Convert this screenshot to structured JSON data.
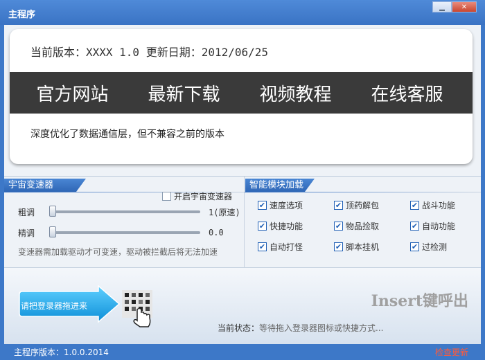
{
  "window": {
    "title": "主程序",
    "min_label": "▁",
    "close_label": "✕"
  },
  "header": {
    "version_line": "当前版本：XXXX 1.0 更新日期：2012/06/25"
  },
  "nav": {
    "items": [
      "官方网站",
      "最新下载",
      "视频教程",
      "在线客服"
    ]
  },
  "notice": "深度优化了数据通信层，但不兼容之前的版本",
  "speed_panel": {
    "title": "宇宙变速器",
    "enable_label": "开启宇宙变速器",
    "enabled": false,
    "coarse_label": "粗调",
    "coarse_value": "1(原速)",
    "coarse_level": 0,
    "fine_label": "精调",
    "fine_value": "0.0",
    "fine_level": 0,
    "note": "变速器需加载驱动才可变速，驱动被拦截后将无法加速"
  },
  "feature_panel": {
    "title": "智能模块加载",
    "items": [
      {
        "label": "速度选项",
        "checked": true
      },
      {
        "label": "顶药解包",
        "checked": true
      },
      {
        "label": "战斗功能",
        "checked": true
      },
      {
        "label": "快捷功能",
        "checked": true
      },
      {
        "label": "物品捡取",
        "checked": true
      },
      {
        "label": "自动功能",
        "checked": true
      },
      {
        "label": "自动打怪",
        "checked": true
      },
      {
        "label": "脚本挂机",
        "checked": true
      },
      {
        "label": "过检测",
        "checked": true
      }
    ]
  },
  "login": {
    "drag_hint": "请把登录器拖进来",
    "hotkey_hint": "Insert键呼出",
    "status_label": "当前状态：",
    "status_text": "等待拖入登录器图标或快捷方式..."
  },
  "statusbar": {
    "version": "主程序版本：1.0.0.2014",
    "check_update": "检查更新"
  },
  "colors": {
    "accent": "#3d78c8",
    "nav_bg": "#3a3a3a",
    "update_link": "#ff5a3a",
    "check_mark": "#1f5fb5"
  }
}
